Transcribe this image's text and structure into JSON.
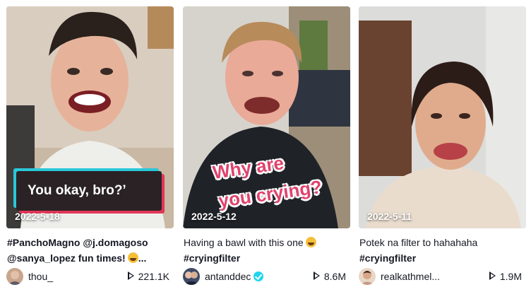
{
  "videos": [
    {
      "date": "2022-5-18",
      "overlay_text": "You okay, bro?’",
      "caption_line1": "#PanchoMagno @j.domagoso",
      "caption_line2": "@sanya_lopez fun times!",
      "caption_line2_suffix": "...",
      "caption_emoji": "rofl-emoji",
      "username": "thou_",
      "verified": false,
      "views": "221.1K"
    },
    {
      "date": "2022-5-12",
      "overlay_line1": "Why are",
      "overlay_line2": "you crying?",
      "caption_line1": "Having a bawl with this one",
      "caption_emoji": "joy-emoji",
      "caption_hashtag": "#cryingfilter",
      "username": "antanddec",
      "verified": true,
      "views": "8.6M"
    },
    {
      "date": "2022-5-11",
      "caption_line1": "Potek na filter to hahahaha",
      "caption_hashtag": "#cryingfilter",
      "username": "realkathmel...",
      "verified": false,
      "views": "1.9M"
    }
  ],
  "colors": {
    "text": "#161823",
    "verified": "#20d5ec",
    "overlay_pink": "#e0436d",
    "overlay_cyan": "#2ac8d8"
  }
}
